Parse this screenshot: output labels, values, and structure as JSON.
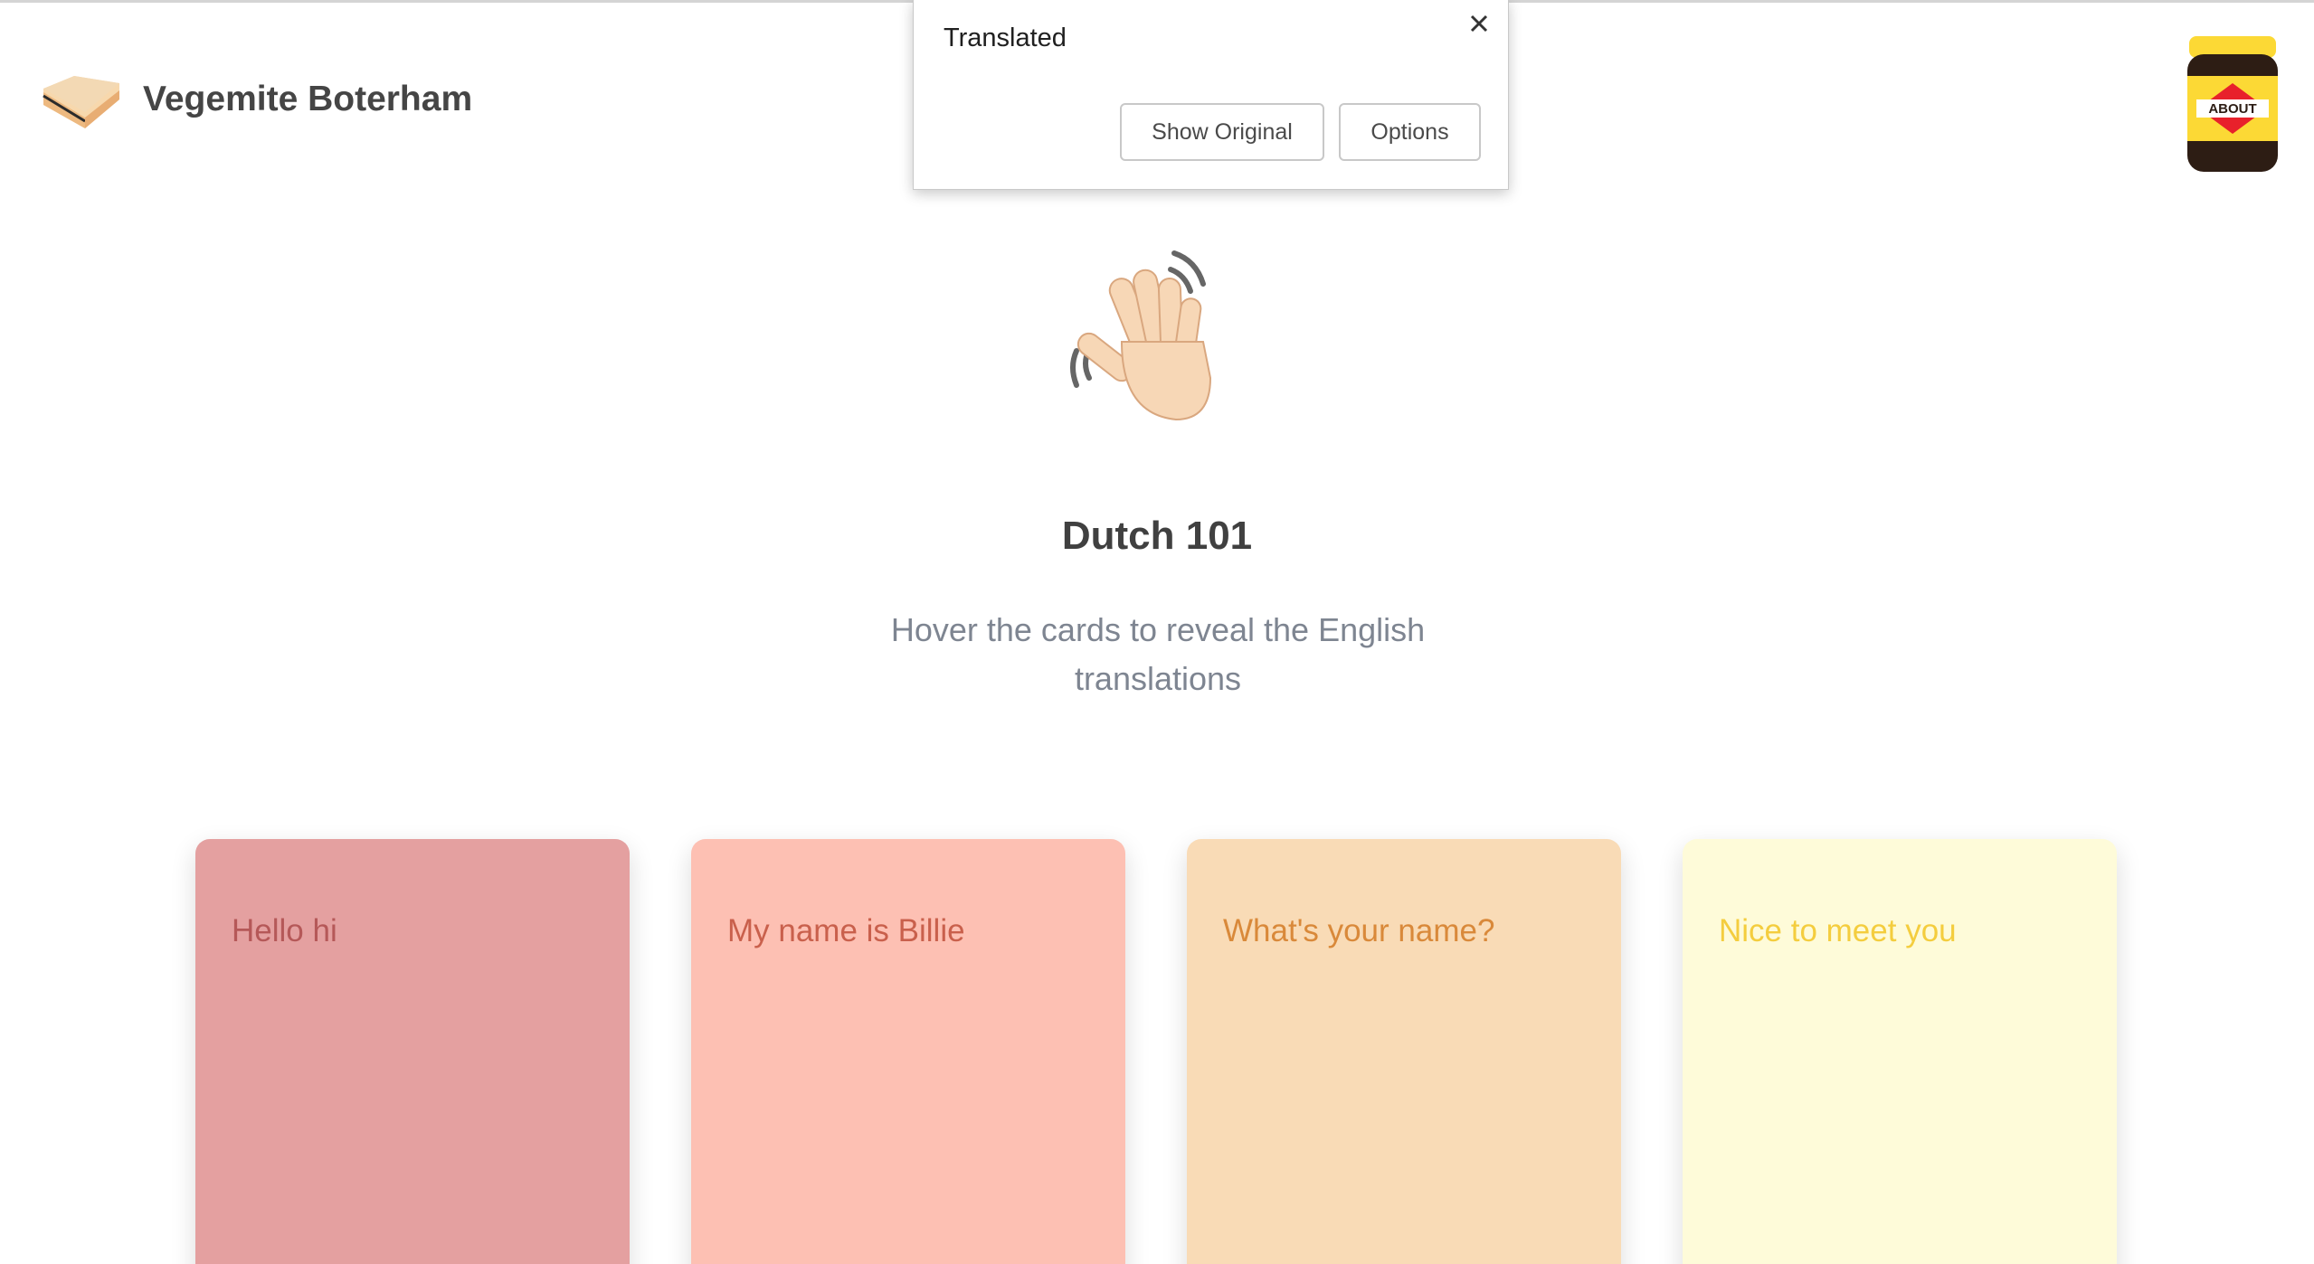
{
  "header": {
    "brand_title": "Vegemite Boterham",
    "about_label": "ABOUT"
  },
  "translate_popup": {
    "title": "Translated",
    "show_original_label": "Show Original",
    "options_label": "Options"
  },
  "hero": {
    "title": "Dutch 101",
    "subtitle": "Hover the cards to reveal the English translations"
  },
  "cards": [
    {
      "text": "Hello hi",
      "bg": "#e4a0a0",
      "fg": "#b55858"
    },
    {
      "text": "My name is Billie",
      "bg": "#fdc0b3",
      "fg": "#c9604c"
    },
    {
      "text": "What's your name?",
      "bg": "#f9dbb6",
      "fg": "#d9893a"
    },
    {
      "text": "Nice to meet you",
      "bg": "#fefbd9",
      "fg": "#f4cd3e"
    }
  ],
  "icons": {
    "logo": "sandwich-logo-icon",
    "about": "vegemite-jar-icon",
    "close": "close-icon",
    "hero": "waving-hand-icon"
  }
}
